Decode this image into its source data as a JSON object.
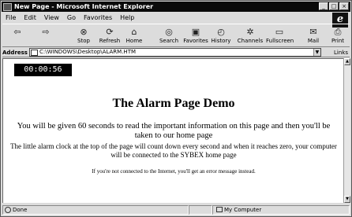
{
  "window": {
    "title": "New Page - Microsoft Internet Explorer",
    "buttons": [
      "_",
      "□",
      "×"
    ]
  },
  "menu": [
    "File",
    "Edit",
    "View",
    "Go",
    "Favorites",
    "Help"
  ],
  "toolbar": [
    {
      "label": "",
      "icon": "back-arrow-icon",
      "glyph": "⇦"
    },
    {
      "label": "",
      "icon": "forward-arrow-icon",
      "glyph": "⇨"
    },
    {
      "label": "Stop",
      "icon": "stop-icon",
      "glyph": "⊗"
    },
    {
      "label": "Refresh",
      "icon": "refresh-icon",
      "glyph": "⟳"
    },
    {
      "label": "Home",
      "icon": "home-icon",
      "glyph": "⌂"
    },
    {
      "label": "Search",
      "icon": "search-icon",
      "glyph": "◎"
    },
    {
      "label": "Favorites",
      "icon": "favorites-icon",
      "glyph": "▣"
    },
    {
      "label": "History",
      "icon": "history-icon",
      "glyph": "◴"
    },
    {
      "label": "Channels",
      "icon": "channels-icon",
      "glyph": "✲"
    },
    {
      "label": "Fullscreen",
      "icon": "fullscreen-icon",
      "glyph": "▭"
    },
    {
      "label": "Mail",
      "icon": "mail-icon",
      "glyph": "✉"
    },
    {
      "label": "Print",
      "icon": "print-icon",
      "glyph": "⎙"
    }
  ],
  "address": {
    "label": "Address",
    "value": "C:\\WINDOWS\\Desktop\\ALARM.HTM",
    "links": "Links"
  },
  "page": {
    "clock": "00:00:56",
    "heading": "The Alarm Page Demo",
    "p1": "You will be given 60 seconds to read the important information on this page and then you'll be taken to our home page",
    "p2": "The little alarm clock at the top of the page will count down every second and when it reaches zero, your computer will be connected to the SYBEX home page",
    "p3": "If you're not connected to the Internet, you'll get an error message instead."
  },
  "status": {
    "left": "Done",
    "zone": "My Computer"
  }
}
